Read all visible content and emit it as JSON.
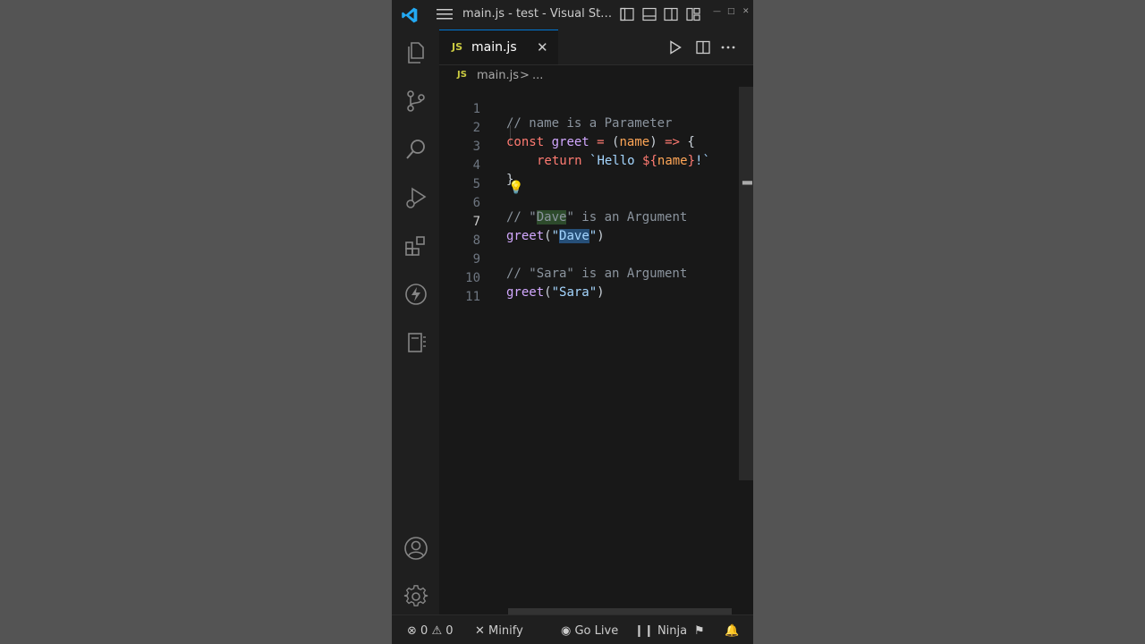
{
  "window": {
    "title": "main.js - test - Visual Studi..."
  },
  "tab": {
    "lang_badge": "JS",
    "label": "main.js",
    "close": "✕"
  },
  "breadcrumb": {
    "lang_badge": "JS",
    "file": "main.js",
    "separator": ">",
    "more": "..."
  },
  "editor": {
    "line_numbers": [
      "1",
      "2",
      "3",
      "4",
      "5",
      "6",
      "7",
      "8",
      "9",
      "10",
      "11"
    ],
    "active_line": "7",
    "lines": [
      {
        "comment": "// name is a Parameter"
      },
      {
        "kw": "const",
        "sp1": " ",
        "fn": "greet",
        "op1": " = ",
        "p1": "(",
        "param": "name",
        "p2": ")",
        "op2": " => ",
        "brace": "{"
      },
      {
        "kw": "return",
        "sp": " ",
        "tpl1": "`Hello ",
        "interp1": "${",
        "param": "name",
        "interp2": "}",
        "tpl2": "!`"
      },
      {
        "brace": "}"
      },
      {},
      {
        "c1": "// \"",
        "hl": "Dave",
        "c2": "\" is an Argument"
      },
      {
        "fn": "greet",
        "p1": "(",
        "q1": "\"",
        "sel": "Dave",
        "q2": "\"",
        "p2": ")"
      },
      {},
      {
        "comment": "// \"Sara\" is an Argument"
      },
      {
        "fn": "greet",
        "p1": "(",
        "str": "\"Sara\"",
        "p2": ")"
      },
      {}
    ]
  },
  "statusbar": {
    "errors": "0",
    "warnings": "0",
    "minify": "Minify",
    "go_live": "Go Live",
    "ninja": "Ninja"
  },
  "colors": {
    "accent": "#0078d4",
    "js_badge": "#cbcb41",
    "background": "#181818"
  }
}
